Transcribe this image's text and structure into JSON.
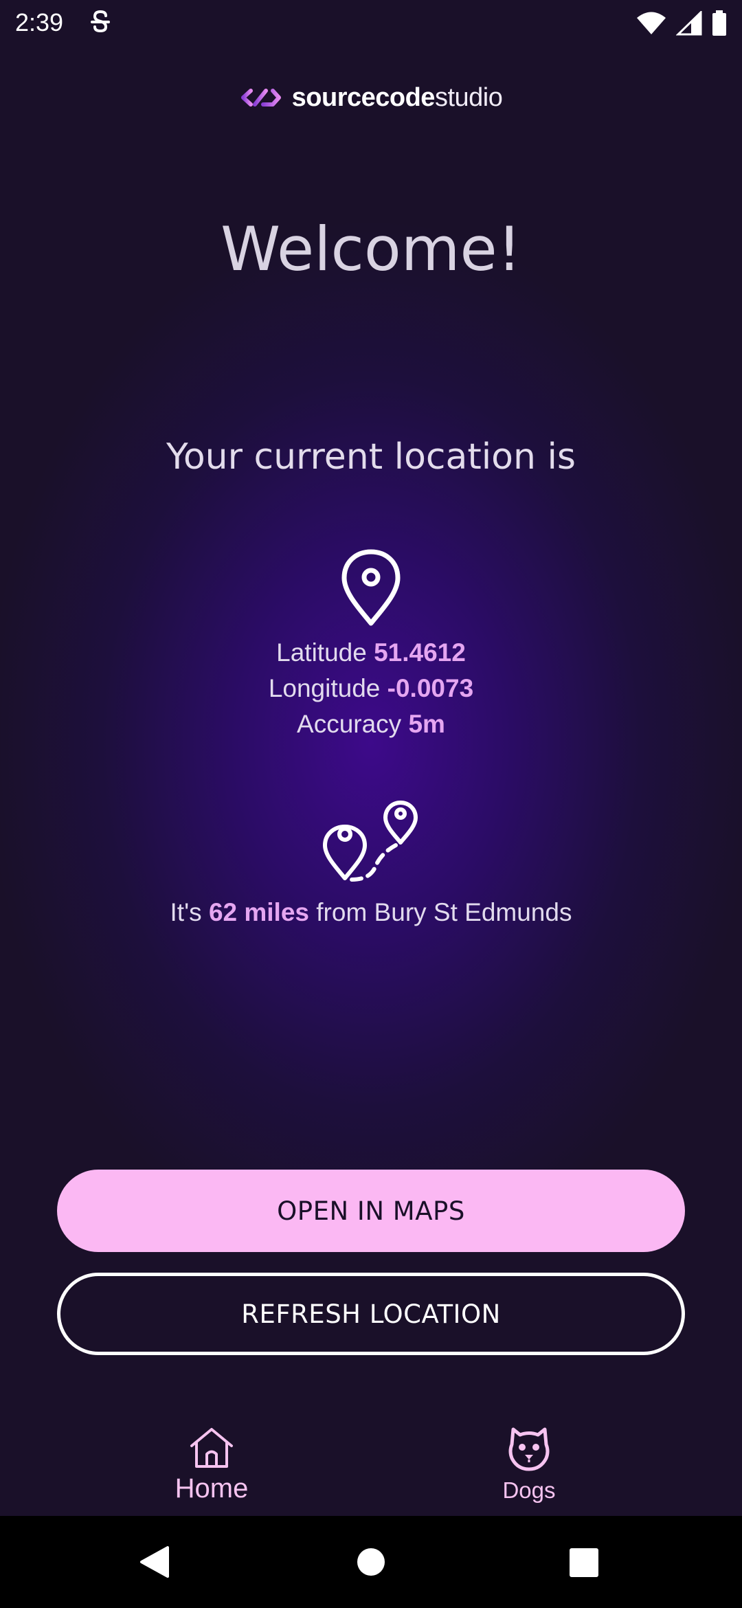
{
  "status_bar": {
    "time": "2:39"
  },
  "logo": {
    "bold_text": "sourcecode",
    "light_text": "studio"
  },
  "main": {
    "welcome": "Welcome!",
    "subtitle": "Your current location is",
    "latitude_label": "Latitude",
    "latitude_value": "51.4612",
    "longitude_label": "Longitude",
    "longitude_value": "-0.0073",
    "accuracy_label": "Accuracy",
    "accuracy_value": "5m",
    "distance_prefix": "It's",
    "distance_value": "62 miles",
    "distance_suffix": "from Bury St Edmunds"
  },
  "buttons": {
    "open_maps": "OPEN IN MAPS",
    "refresh": "REFRESH LOCATION"
  },
  "bottom_nav": {
    "home_label": "Home",
    "dogs_label": "Dogs"
  },
  "icons": {
    "location": "map-pin-icon",
    "route": "route-icon",
    "home": "home-icon",
    "dogs": "dog-face-icon"
  },
  "colors": {
    "background": "#1a1029",
    "glow": "#3d0a8a",
    "accent": "#fbb8f3",
    "value_text": "#e5a6f1"
  }
}
